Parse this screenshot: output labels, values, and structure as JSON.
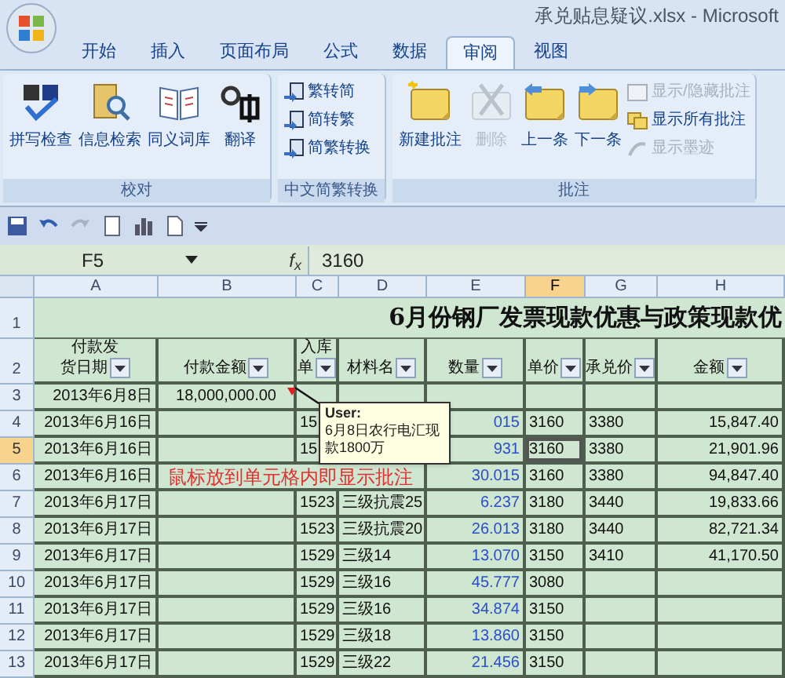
{
  "window": {
    "title": "承兑贴息疑议.xlsx - Microsoft"
  },
  "tabs": [
    {
      "label": "开始",
      "selected": false
    },
    {
      "label": "插入",
      "selected": false
    },
    {
      "label": "页面布局",
      "selected": false
    },
    {
      "label": "公式",
      "selected": false
    },
    {
      "label": "数据",
      "selected": false
    },
    {
      "label": "审阅",
      "selected": true
    },
    {
      "label": "视图",
      "selected": false
    }
  ],
  "ribbon_groups": [
    {
      "label": "校对",
      "buttons": [
        {
          "kind": "large",
          "label": "拼写检查",
          "disabled": false
        },
        {
          "kind": "large",
          "label": "信息检索",
          "disabled": false
        },
        {
          "kind": "large",
          "label": "同义词库",
          "disabled": false
        },
        {
          "kind": "large",
          "label": "翻译",
          "disabled": false
        }
      ]
    },
    {
      "label": "中文简繁转换",
      "buttons": [
        {
          "kind": "small",
          "label": "繁转简",
          "disabled": false
        },
        {
          "kind": "small",
          "label": "简转繁",
          "disabled": false
        },
        {
          "kind": "small",
          "label": "简繁转换",
          "disabled": false
        }
      ]
    },
    {
      "label": "批注",
      "buttons": [
        {
          "kind": "large",
          "label": "新建批注",
          "disabled": false
        },
        {
          "kind": "large",
          "label": "删除",
          "disabled": true
        },
        {
          "kind": "large",
          "label": "上一条",
          "disabled": false
        },
        {
          "kind": "large",
          "label": "下一条",
          "disabled": false
        },
        {
          "kind": "small",
          "label": "显示/隐藏批注",
          "disabled": true
        },
        {
          "kind": "small",
          "label": "显示所有批注",
          "disabled": false
        },
        {
          "kind": "small",
          "label": "显示墨迹",
          "disabled": true
        }
      ]
    }
  ],
  "formula_bar": {
    "name_box": "F5",
    "fx_label": "f$_{x}$",
    "formula": "3160"
  },
  "sheet": {
    "columns": [
      {
        "letter": "A",
        "selected": false
      },
      {
        "letter": "B",
        "selected": false
      },
      {
        "letter": "C",
        "selected": false
      },
      {
        "letter": "D",
        "selected": false
      },
      {
        "letter": "E",
        "selected": false
      },
      {
        "letter": "F",
        "selected": true
      },
      {
        "letter": "G",
        "selected": false
      },
      {
        "letter": "H",
        "selected": false
      }
    ],
    "title_row": {
      "number": "1",
      "text": "6月份钢厂发票现款优惠与政策现款优"
    },
    "header_row": {
      "number": "2",
      "headers": [
        {
          "lines": [
            "付款发",
            "货日期"
          ]
        },
        {
          "lines": [
            "付款金额"
          ]
        },
        {
          "lines": [
            "入库",
            "单"
          ]
        },
        {
          "lines": [
            "材料名"
          ]
        },
        {
          "lines": [
            "数量"
          ]
        },
        {
          "lines": [
            "单价"
          ]
        },
        {
          "lines": [
            "承兑价"
          ]
        },
        {
          "lines": [
            "金额"
          ]
        }
      ]
    },
    "rows": [
      {
        "number": "3",
        "selected": false,
        "cells": {
          "A": "2013年6月8日",
          "B": "18,000,000.00"
        }
      },
      {
        "number": "4",
        "selected": false,
        "cells": {
          "A": "2013年6月16日",
          "C": "15",
          "E": "015",
          "F": "3160",
          "G": "3380",
          "H": "15,847.40"
        }
      },
      {
        "number": "5",
        "selected": true,
        "cells": {
          "A": "2013年6月16日",
          "C": "15",
          "E": "931",
          "F": "3160",
          "G": "3380",
          "H": "21,901.96"
        }
      },
      {
        "number": "6",
        "selected": false,
        "annotation": "鼠标放到单元格内即显示批注",
        "cells": {
          "A": "2013年6月16日",
          "E": "30.015",
          "F": "3160",
          "G": "3380",
          "H": "94,847.40"
        }
      },
      {
        "number": "7",
        "selected": false,
        "cells": {
          "A": "2013年6月17日",
          "C": "1523",
          "D": "三级抗震25",
          "E": "6.237",
          "F": "3180",
          "G": "3440",
          "H": "19,833.66"
        }
      },
      {
        "number": "8",
        "selected": false,
        "cells": {
          "A": "2013年6月17日",
          "C": "1523",
          "D": "三级抗震20",
          "E": "26.013",
          "F": "3180",
          "G": "3440",
          "H": "82,721.34"
        }
      },
      {
        "number": "9",
        "selected": false,
        "cells": {
          "A": "2013年6月17日",
          "C": "1529",
          "D": "三级14",
          "E": "13.070",
          "F": "3150",
          "G": "3410",
          "H": "41,170.50"
        }
      },
      {
        "number": "10",
        "selected": false,
        "cells": {
          "A": "2013年6月17日",
          "C": "1529",
          "D": "三级16",
          "E": "45.777",
          "F": "3080"
        }
      },
      {
        "number": "11",
        "selected": false,
        "cells": {
          "A": "2013年6月17日",
          "C": "1529",
          "D": "三级16",
          "E": "34.874",
          "F": "3150"
        }
      },
      {
        "number": "12",
        "selected": false,
        "cells": {
          "A": "2013年6月17日",
          "C": "1529",
          "D": "三级18",
          "E": "13.860",
          "F": "3150"
        }
      },
      {
        "number": "13",
        "selected": false,
        "cells": {
          "A": "2013年6月17日",
          "C": "1529",
          "D": "三级22",
          "E": "21.456",
          "F": "3150"
        }
      }
    ],
    "comment": {
      "author": "User:",
      "text": "6月8日农行电汇现款1800万"
    }
  }
}
